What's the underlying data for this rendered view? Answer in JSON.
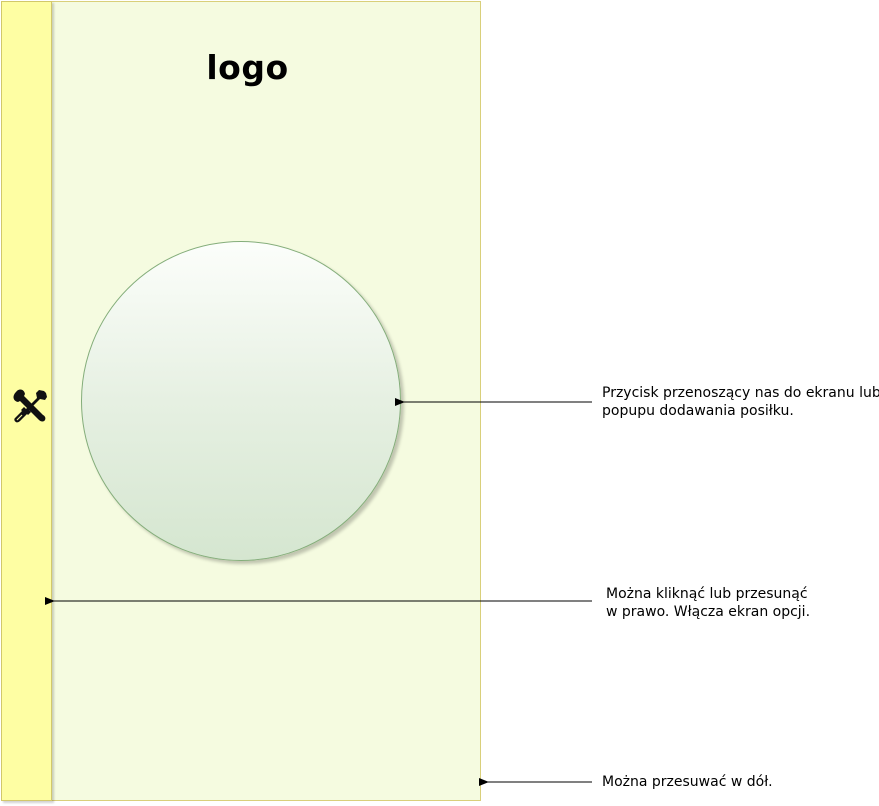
{
  "logo": {
    "text": "logo"
  },
  "side_bar": {
    "icon": "tools-icon"
  },
  "add_button": {
    "icon": "none"
  },
  "annotations": {
    "add_button_note": [
      "Przycisk przenoszący nas do ekranu lub",
      "popupu dodawania posiłku."
    ],
    "side_bar_note": [
      "Można kliknąć lub przesunąć",
      "w prawo. Włącza ekran opcji."
    ],
    "scroll_note": [
      "Można przesuwać w dół."
    ]
  },
  "colors": {
    "screen_bg": "#f5fbe0",
    "side_bar_bg": "#fefea3",
    "button_gradient_top": "#fcfefb",
    "button_gradient_bottom": "#d5e6d0",
    "button_border": "#84ad7a"
  }
}
